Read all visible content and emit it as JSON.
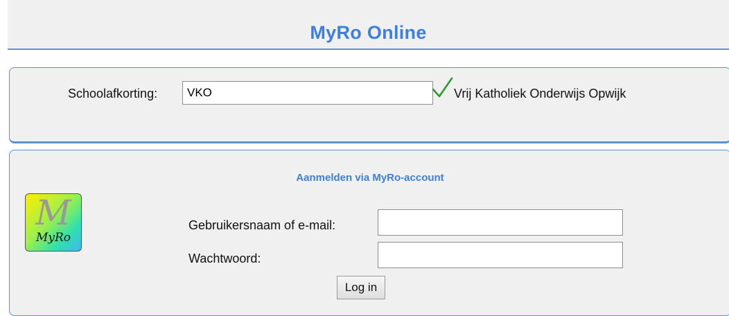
{
  "header": {
    "title": "MyRo Online"
  },
  "school": {
    "label": "Schoolafkorting:",
    "value": "VKO",
    "status_icon": "check-icon",
    "status_color": "#2e9a2e",
    "school_name": "Vrij Katholiek Onderwijs Opwijk"
  },
  "login": {
    "heading": "Aanmelden via MyRo-account",
    "logo": {
      "letter": "M",
      "text": "MyRo"
    },
    "username_label": "Gebruikersnaam of e-mail:",
    "username_value": "",
    "password_label": "Wachtwoord:",
    "password_value": "",
    "submit_label": "Log in"
  },
  "colors": {
    "accent": "#3d7fe0",
    "panel_bg": "#f0f0f0",
    "border": "#5b8fd6"
  }
}
